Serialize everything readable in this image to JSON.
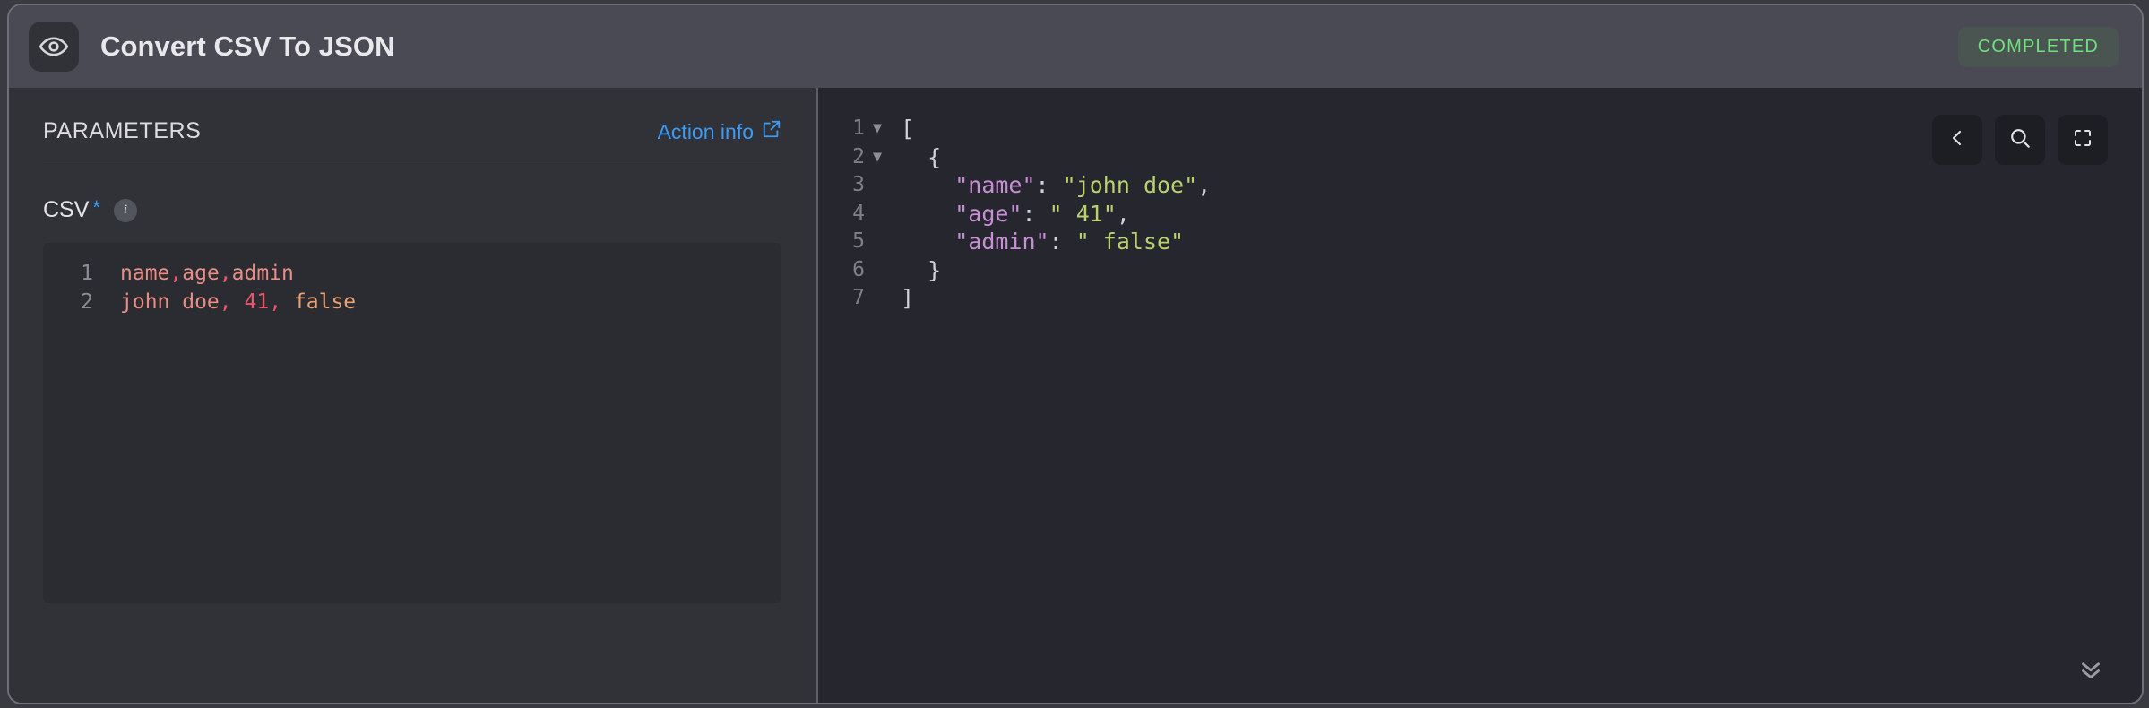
{
  "header": {
    "icon": "eye-icon",
    "title": "Convert CSV To JSON",
    "status": "COMPLETED",
    "status_color": "#6ee07c",
    "status_bg": "#4a5450"
  },
  "parameters": {
    "section_label": "PARAMETERS",
    "action_info_label": "Action info",
    "action_info_icon": "external-link-icon",
    "accent_color": "#3d9bf5",
    "fields": [
      {
        "label": "CSV",
        "required_marker": "*",
        "info_icon": "info-circle-icon",
        "info_icon_letter": "i",
        "editor": {
          "lines": [
            {
              "number": "1",
              "tokens": [
                {
                  "text": "name",
                  "class": "t-salmon"
                },
                {
                  "text": ",",
                  "class": "t-pink"
                },
                {
                  "text": "age",
                  "class": "t-salmon"
                },
                {
                  "text": ",",
                  "class": "t-pink"
                },
                {
                  "text": "admin",
                  "class": "t-salmon"
                }
              ]
            },
            {
              "number": "2",
              "tokens": [
                {
                  "text": "john doe",
                  "class": "t-salmon"
                },
                {
                  "text": ",",
                  "class": "t-pink"
                },
                {
                  "text": " ",
                  "class": "t-salmon"
                },
                {
                  "text": "41",
                  "class": "t-pink"
                },
                {
                  "text": ",",
                  "class": "t-pink"
                },
                {
                  "text": " ",
                  "class": "t-salmon"
                },
                {
                  "text": "false",
                  "class": "t-orange"
                }
              ]
            }
          ]
        }
      }
    ]
  },
  "output": {
    "toolbar": [
      {
        "name": "back-button",
        "icon": "chevron-left-icon"
      },
      {
        "name": "search-button",
        "icon": "search-icon"
      },
      {
        "name": "fullscreen-button",
        "icon": "fullscreen-icon"
      }
    ],
    "scroll_more_icon": "chevrons-down-icon",
    "json_text": "[\n  {\n    \"name\": \"john doe\",\n    \"age\": \" 41\",\n    \"admin\": \" false\"\n  }\n]",
    "lines": [
      {
        "number": "1",
        "fold": "▼",
        "tokens": [
          {
            "text": "[",
            "class": "j-punct"
          }
        ]
      },
      {
        "number": "2",
        "fold": "▼",
        "tokens": [
          {
            "text": "  {",
            "class": "j-punct"
          }
        ]
      },
      {
        "number": "3",
        "fold": "",
        "tokens": [
          {
            "text": "    ",
            "class": "j-punct"
          },
          {
            "text": "\"name\"",
            "class": "j-key"
          },
          {
            "text": ": ",
            "class": "j-punct"
          },
          {
            "text": "\"john doe\"",
            "class": "j-str"
          },
          {
            "text": ",",
            "class": "j-punct"
          }
        ]
      },
      {
        "number": "4",
        "fold": "",
        "tokens": [
          {
            "text": "    ",
            "class": "j-punct"
          },
          {
            "text": "\"age\"",
            "class": "j-key"
          },
          {
            "text": ": ",
            "class": "j-punct"
          },
          {
            "text": "\" 41\"",
            "class": "j-str"
          },
          {
            "text": ",",
            "class": "j-punct"
          }
        ]
      },
      {
        "number": "5",
        "fold": "",
        "tokens": [
          {
            "text": "    ",
            "class": "j-punct"
          },
          {
            "text": "\"admin\"",
            "class": "j-key"
          },
          {
            "text": ": ",
            "class": "j-punct"
          },
          {
            "text": "\" false\"",
            "class": "j-str"
          }
        ]
      },
      {
        "number": "6",
        "fold": "",
        "tokens": [
          {
            "text": "  }",
            "class": "j-punct"
          }
        ]
      },
      {
        "number": "7",
        "fold": "",
        "tokens": [
          {
            "text": "]",
            "class": "j-punct"
          }
        ]
      }
    ]
  }
}
